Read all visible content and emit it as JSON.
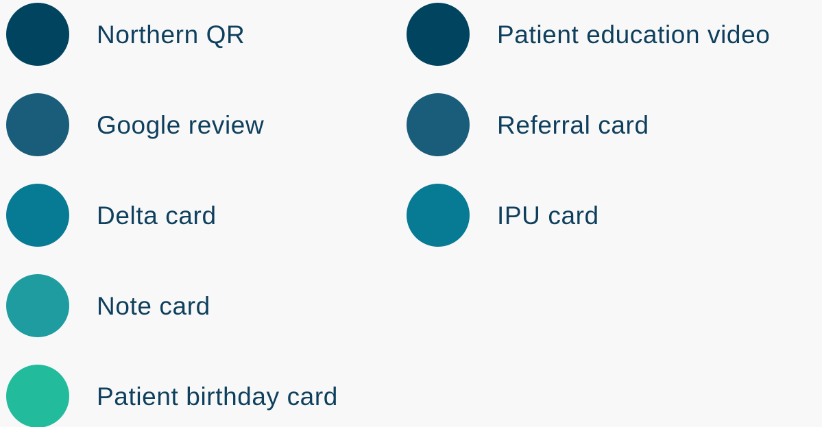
{
  "chart_data": {
    "type": "legend",
    "title": "",
    "series": [
      {
        "name": "Northern QR",
        "color": "#01445f"
      },
      {
        "name": "Google review",
        "color": "#1a5d7a"
      },
      {
        "name": "Delta card",
        "color": "#077a94"
      },
      {
        "name": "Note card",
        "color": "#1f9c9f"
      },
      {
        "name": "Patient birthday card",
        "color": "#22bb9c"
      },
      {
        "name": "Patient education video",
        "color": "#01445f"
      },
      {
        "name": "Referral card",
        "color": "#1a5d7a"
      },
      {
        "name": "IPU card",
        "color": "#077a94"
      }
    ]
  }
}
